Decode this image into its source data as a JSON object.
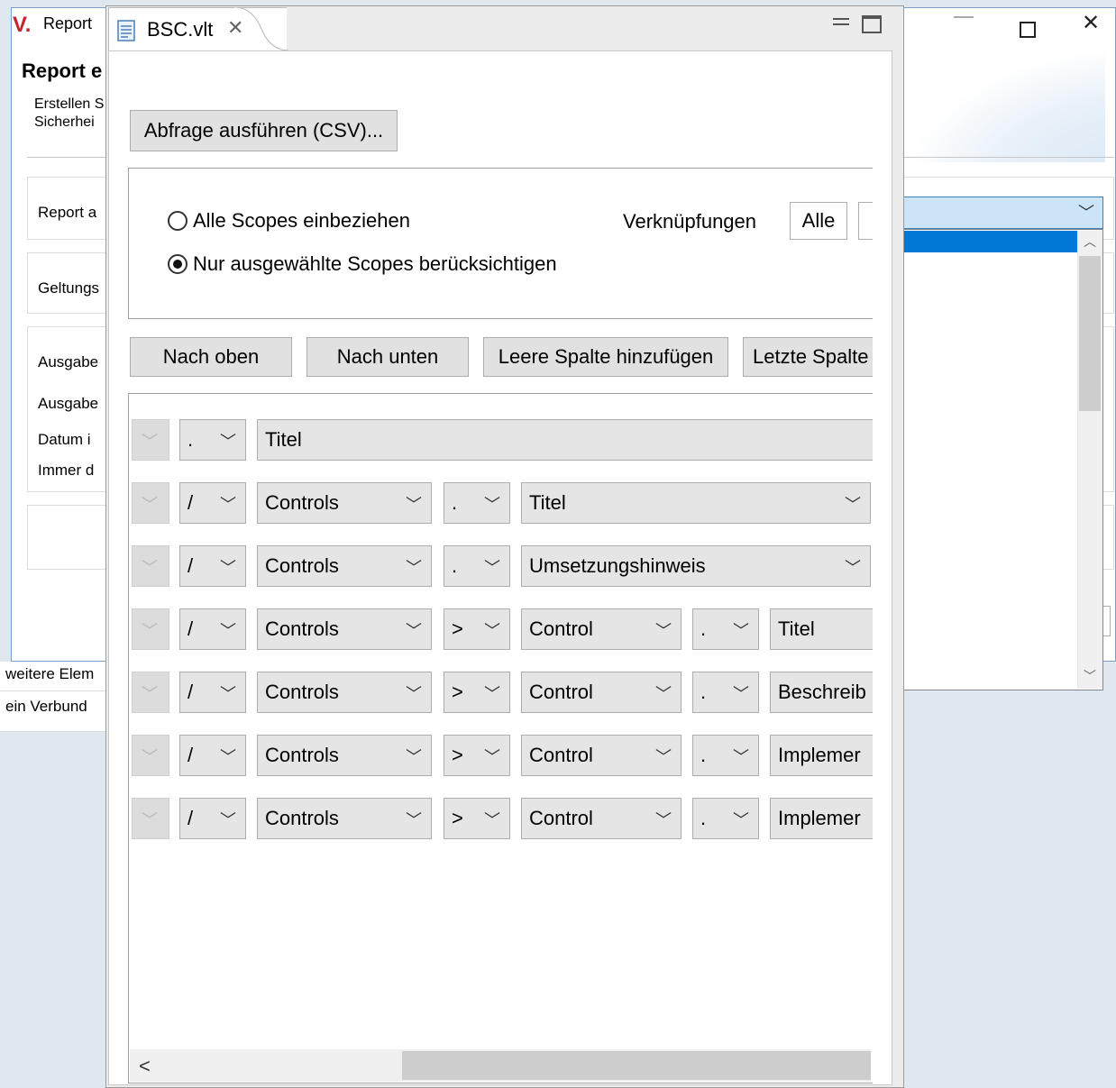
{
  "background_dialog": {
    "app_title": "Report",
    "header_title": "Report e",
    "description_lines": [
      "Erstellen S",
      "Sicherhei"
    ],
    "field_labels": [
      "Report a",
      "Geltungs",
      "Ausgabe",
      "Ausgabe",
      "Datum i",
      "Immer d"
    ],
    "bottom_lines": [
      "weitere Elem",
      "ein Verbund"
    ]
  },
  "editor": {
    "tab_label": "BSC.vlt",
    "run_button": "Abfrage ausführen (CSV)...",
    "scope_options": [
      {
        "label": "Alle Scopes einbeziehen",
        "checked": false
      },
      {
        "label": "Nur ausgewählte Scopes berücksichtigen",
        "checked": true
      }
    ],
    "links_label": "Verknüpfungen",
    "links_all_button": "Alle",
    "column_buttons": [
      "Nach oben",
      "Nach unten",
      "Leere Spalte hinzufügen",
      "Letzte Spalte"
    ],
    "rows": [
      [
        "",
        ".",
        "Titel"
      ],
      [
        "",
        "/",
        "Controls",
        ".",
        "Titel"
      ],
      [
        "",
        "/",
        "Controls",
        ".",
        "Umsetzungshinweis"
      ],
      [
        "",
        "/",
        "Controls",
        ">",
        "Control",
        ".",
        "Titel"
      ],
      [
        "",
        "/",
        "Controls",
        ">",
        "Control",
        ".",
        "Beschreib"
      ],
      [
        "",
        "/",
        "Controls",
        ">",
        "Control",
        ".",
        "Implemer"
      ],
      [
        "",
        "/",
        "Controls",
        ">",
        "Control",
        ".",
        "Implemer"
      ]
    ]
  },
  "colors": {
    "accent_select": "#cce4f7",
    "selection_blue": "#0078d7",
    "logo_red": "#c4262e"
  }
}
